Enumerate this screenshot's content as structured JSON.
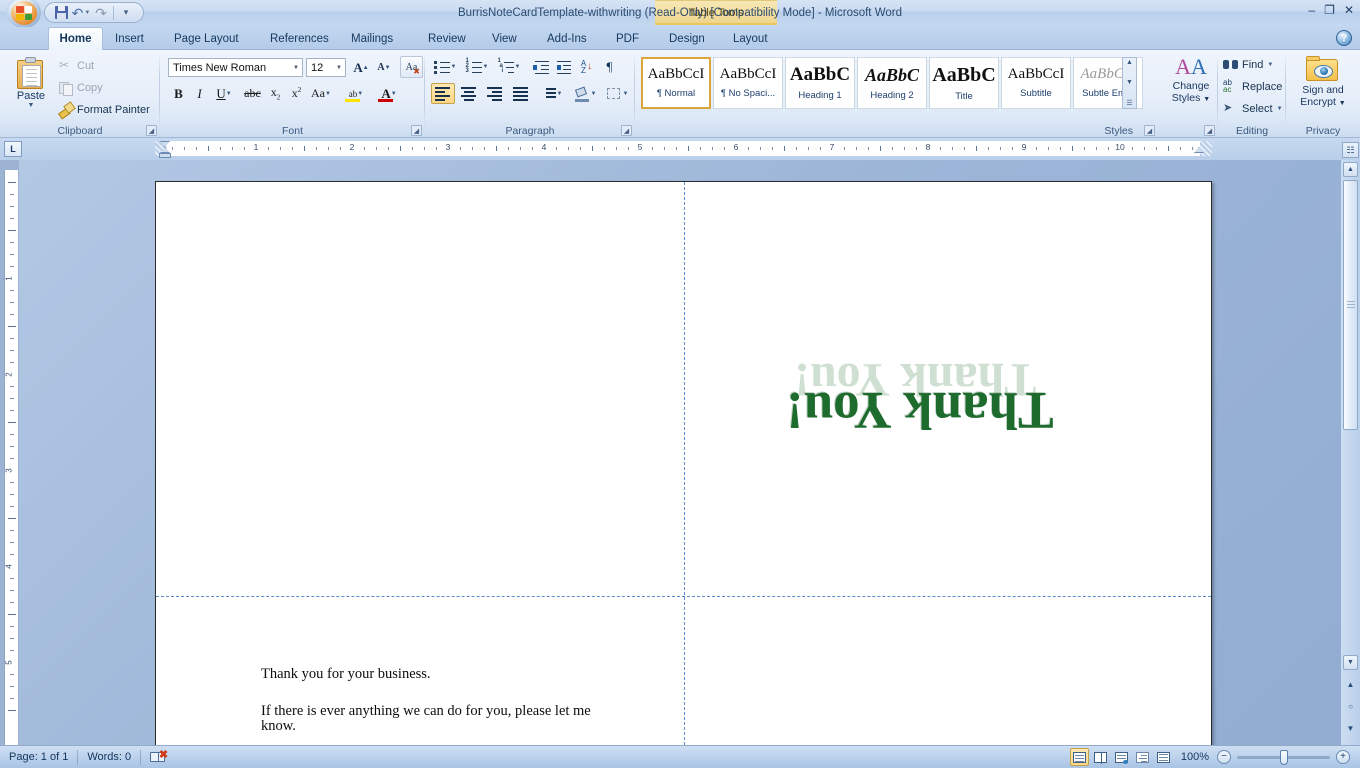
{
  "window": {
    "title": "BurrisNoteCardTemplate-withwriting (Read-Only) [Compatibility Mode] - Microsoft Word",
    "contextual_tab_set": "Table Tools",
    "minimize": "–",
    "restore": "❐",
    "close": "✕",
    "help": "?"
  },
  "quick_access": {
    "save": "save-icon",
    "undo": "undo-icon",
    "redo": "redo-icon",
    "customize": "customize-qat-icon"
  },
  "tabs": [
    {
      "label": "Home",
      "active": true
    },
    {
      "label": "Insert",
      "active": false
    },
    {
      "label": "Page Layout",
      "active": false
    },
    {
      "label": "References",
      "active": false
    },
    {
      "label": "Mailings",
      "active": false
    },
    {
      "label": "Review",
      "active": false
    },
    {
      "label": "View",
      "active": false
    },
    {
      "label": "Add-Ins",
      "active": false
    },
    {
      "label": "PDF",
      "active": false
    },
    {
      "label": "Design",
      "active": false
    },
    {
      "label": "Layout",
      "active": false
    }
  ],
  "ribbon": {
    "clipboard": {
      "label": "Clipboard",
      "paste": "Paste",
      "cut": "Cut",
      "copy": "Copy",
      "format_painter": "Format Painter"
    },
    "font": {
      "label": "Font",
      "font_name": "Times New Roman",
      "font_size": "12",
      "grow_font": "A",
      "shrink_font": "A",
      "clear_formatting": "Aa",
      "bold": "B",
      "italic": "I",
      "underline": "U",
      "strikethrough": "abc",
      "subscript": "x",
      "superscript": "x",
      "change_case": "Aa",
      "highlight": "ab",
      "font_color": "A"
    },
    "paragraph": {
      "label": "Paragraph",
      "bullets": "bullets-icon",
      "numbering": "numbering-icon",
      "multilevel_list": "multilevel-list-icon",
      "decrease_indent": "decrease-indent-icon",
      "increase_indent": "increase-indent-icon",
      "sort": "sort-icon",
      "show_marks": "¶",
      "align_left": "align-left-icon",
      "center": "align-center-icon",
      "align_right": "align-right-icon",
      "justify": "justify-icon",
      "line_spacing": "line-spacing-icon",
      "shading": "shading-icon",
      "borders": "borders-icon"
    },
    "styles": {
      "label": "Styles",
      "items": [
        {
          "preview": "AaBbCcI",
          "name": "¶ Normal",
          "selected": true,
          "size": 15,
          "weight": "normal",
          "style": "normal",
          "color": "#111111"
        },
        {
          "preview": "AaBbCcI",
          "name": "¶ No Spaci...",
          "selected": false,
          "size": 15,
          "weight": "normal",
          "style": "normal",
          "color": "#111111"
        },
        {
          "preview": "AaBbC",
          "name": "Heading 1",
          "selected": false,
          "size": 19,
          "weight": "bold",
          "style": "normal",
          "color": "#111111"
        },
        {
          "preview": "AaBbC",
          "name": "Heading 2",
          "selected": false,
          "size": 18,
          "weight": "bold",
          "style": "italic",
          "color": "#111111"
        },
        {
          "preview": "AaBbC",
          "name": "Title",
          "selected": false,
          "size": 20,
          "weight": "bold",
          "style": "normal",
          "color": "#111111"
        },
        {
          "preview": "AaBbCcI",
          "name": "Subtitle",
          "selected": false,
          "size": 15,
          "weight": "normal",
          "style": "normal",
          "color": "#111111"
        },
        {
          "preview": "AaBbCcI",
          "name": "Subtle Em...",
          "selected": false,
          "size": 15,
          "weight": "normal",
          "style": "italic",
          "color": "#8c8c8c"
        }
      ]
    },
    "change_styles": {
      "line1": "Change",
      "line2": "Styles"
    },
    "editing": {
      "label": "Editing",
      "find": "Find",
      "replace": "Replace",
      "select": "Select"
    },
    "privacy": {
      "label": "Privacy",
      "line1": "Sign and",
      "line2": "Encrypt"
    }
  },
  "ruler": {
    "tab_selector": "L",
    "h_numbers": [
      "1",
      "2",
      "3",
      "4",
      "5",
      "6",
      "7",
      "8",
      "9",
      "10"
    ],
    "v_numbers": [
      "1",
      "2",
      "3",
      "4"
    ]
  },
  "document": {
    "card_greeting": "Thank You!",
    "card_greeting_shadow": "Thank You!",
    "greeting_color": "#1e6b2e",
    "greeting_shadow_color": "#cfe0d2",
    "body_lines": [
      "Thank you for your business.",
      "If there is ever anything we can do for you, please let me know."
    ]
  },
  "status_bar": {
    "page": "Page: 1 of 1",
    "words": "Words: 0",
    "proofing": "proofing-errors-icon",
    "views": [
      {
        "name": "print-layout-view",
        "selected": true
      },
      {
        "name": "full-screen-reading-view",
        "selected": false
      },
      {
        "name": "web-layout-view",
        "selected": false
      },
      {
        "name": "outline-view",
        "selected": false
      },
      {
        "name": "draft-view",
        "selected": false
      }
    ],
    "zoom": "100%",
    "zoom_out": "−",
    "zoom_in": "+"
  }
}
